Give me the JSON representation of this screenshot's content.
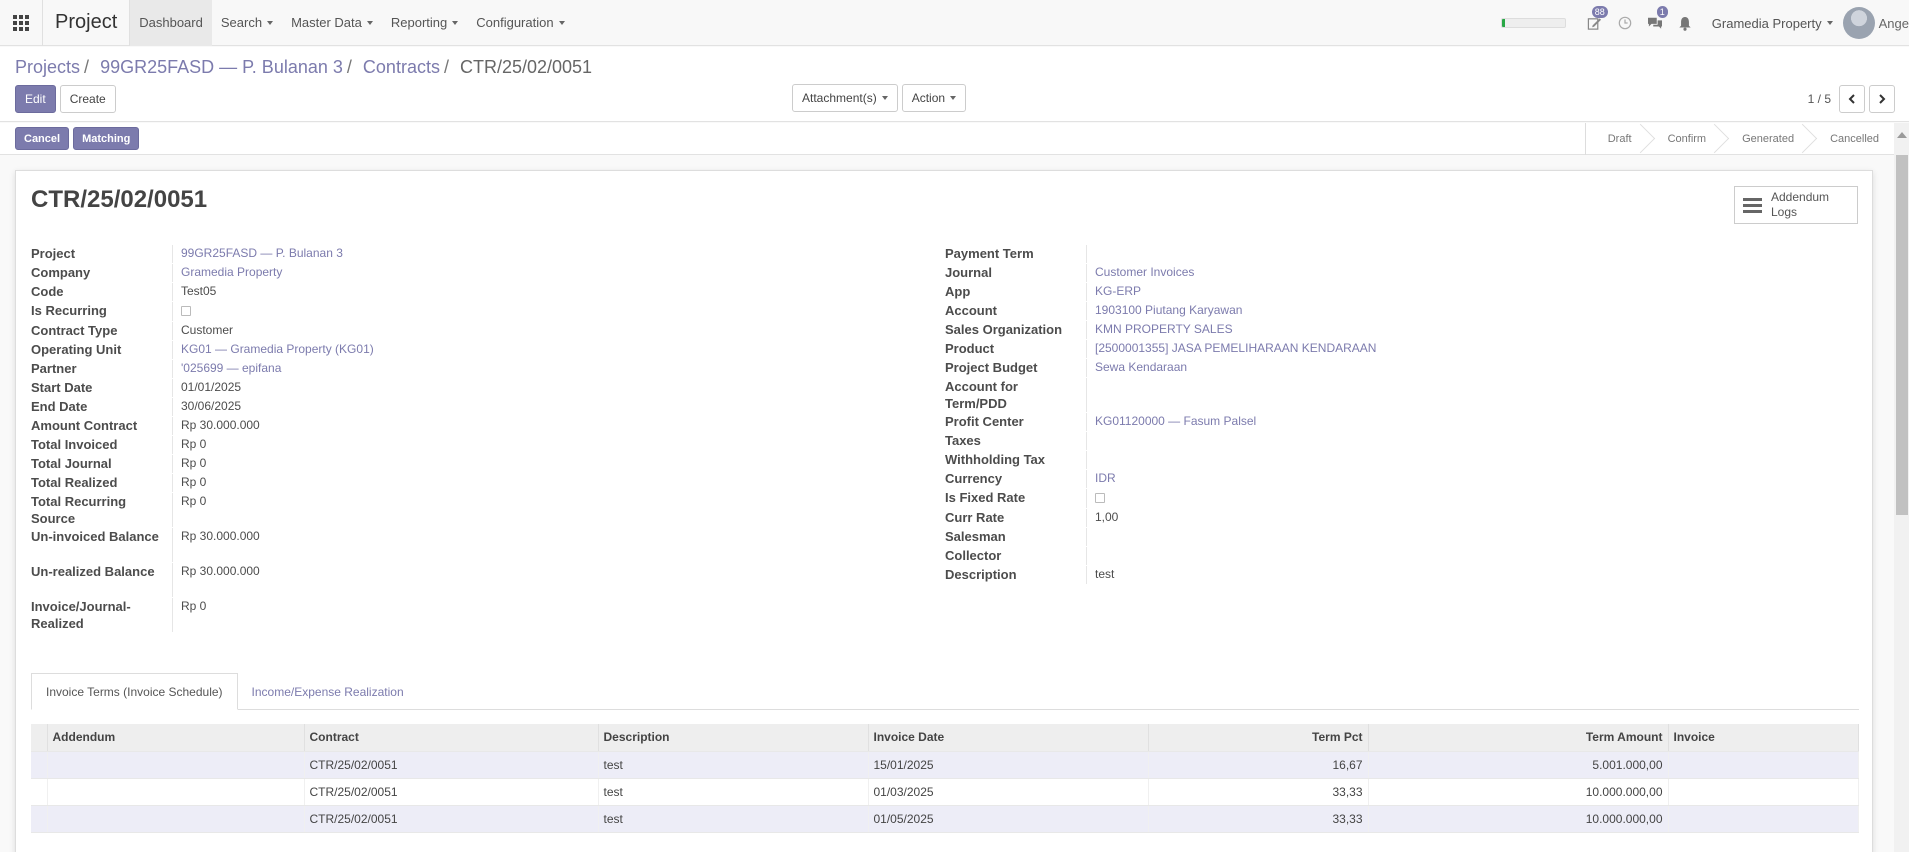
{
  "navbar": {
    "app_name": "Project",
    "menu": [
      "Dashboard",
      "Search",
      "Master Data",
      "Reporting",
      "Configuration"
    ],
    "progress": 0.05,
    "activity_badge": "88",
    "chat_badge": "1",
    "company": "Gramedia Property",
    "user_name": "Ange"
  },
  "breadcrumb": {
    "items": [
      "Projects",
      "99GR25FASD — P. Bulanan 3",
      "Contracts"
    ],
    "current": "CTR/25/02/0051"
  },
  "control": {
    "edit": "Edit",
    "create": "Create",
    "attachments": "Attachment(s)",
    "action": "Action",
    "pager": "1 / 5"
  },
  "status": {
    "cancel": "Cancel",
    "matching": "Matching",
    "stages": [
      "Draft",
      "Confirm",
      "Generated",
      "Cancelled"
    ]
  },
  "record": {
    "title": "CTR/25/02/0051",
    "smart_button": "Addendum Logs"
  },
  "left_fields": [
    {
      "label": "Project",
      "value": "99GR25FASD — P. Bulanan 3",
      "link": true
    },
    {
      "label": "Company",
      "value": "Gramedia Property",
      "link": true
    },
    {
      "label": "Code",
      "value": "Test05"
    },
    {
      "label": "Is Recurring",
      "value": "",
      "checkbox": true
    },
    {
      "label": "Contract Type",
      "value": "Customer"
    },
    {
      "label": "Operating Unit",
      "value": "KG01 — Gramedia Property (KG01)",
      "link": true
    },
    {
      "label": "Partner",
      "value": "'025699 — epifana",
      "link": true
    },
    {
      "label": "Start Date",
      "value": "01/01/2025"
    },
    {
      "label": "End Date",
      "value": "30/06/2025"
    },
    {
      "label": "Amount Contract",
      "value": "Rp 30.000.000"
    },
    {
      "label": "Total Invoiced",
      "value": "Rp 0"
    },
    {
      "label": "Total Journal",
      "value": "Rp 0"
    },
    {
      "label": "Total Realized",
      "value": "Rp 0"
    },
    {
      "label": "Total Recurring Source",
      "value": "Rp 0"
    },
    {
      "label": "Un-invoiced Balance",
      "value": "Rp 30.000.000"
    },
    {
      "label": "Un-realized Balance",
      "value": "Rp 30.000.000"
    },
    {
      "label": "Invoice/Journal-Realized",
      "value": "Rp 0"
    }
  ],
  "right_fields": [
    {
      "label": "Payment Term",
      "value": ""
    },
    {
      "label": "Journal",
      "value": "Customer Invoices",
      "link": true
    },
    {
      "label": "App",
      "value": "KG-ERP",
      "link": true
    },
    {
      "label": "Account",
      "value": "1903100 Piutang Karyawan",
      "link": true
    },
    {
      "label": "Sales Organization",
      "value": "KMN PROPERTY SALES",
      "link": true
    },
    {
      "label": "Product",
      "value": "[2500001355] JASA PEMELIHARAAN KENDARAAN",
      "link": true
    },
    {
      "label": "Project Budget",
      "value": "Sewa Kendaraan",
      "link": true
    },
    {
      "label": "Account for Term/PDD",
      "value": ""
    },
    {
      "label": "Profit Center",
      "value": "KG01120000 — Fasum Palsel",
      "link": true
    },
    {
      "label": "Taxes",
      "value": ""
    },
    {
      "label": "Withholding Tax",
      "value": ""
    },
    {
      "label": "Currency",
      "value": "IDR",
      "link": true
    },
    {
      "label": "Is Fixed Rate",
      "value": "",
      "checkbox": true
    },
    {
      "label": "Curr Rate",
      "value": "1,00"
    },
    {
      "label": "Salesman",
      "value": ""
    },
    {
      "label": "Collector",
      "value": ""
    },
    {
      "label": "Description",
      "value": "test"
    }
  ],
  "tabs": [
    "Invoice Terms (Invoice Schedule)",
    "Income/Expense Realization"
  ],
  "table": {
    "headers": [
      "Addendum",
      "Contract",
      "Description",
      "Invoice Date",
      "Term Pct",
      "Term Amount",
      "Invoice"
    ],
    "rows": [
      {
        "addendum": "",
        "contract": "CTR/25/02/0051",
        "description": "test",
        "invoice_date": "15/01/2025",
        "term_pct": "16,67",
        "term_amount": "5.001.000,00",
        "invoice": ""
      },
      {
        "addendum": "",
        "contract": "CTR/25/02/0051",
        "description": "test",
        "invoice_date": "01/03/2025",
        "term_pct": "33,33",
        "term_amount": "10.000.000,00",
        "invoice": ""
      },
      {
        "addendum": "",
        "contract": "CTR/25/02/0051",
        "description": "test",
        "invoice_date": "01/05/2025",
        "term_pct": "33,33",
        "term_amount": "10.000.000,00",
        "invoice": ""
      }
    ]
  }
}
